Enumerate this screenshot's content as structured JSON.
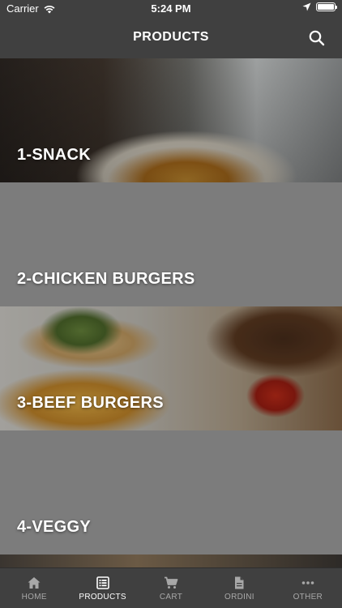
{
  "status_bar": {
    "carrier": "Carrier",
    "time": "5:24 PM"
  },
  "header": {
    "title": "PRODUCTS"
  },
  "categories": [
    {
      "label": "1-SNACK"
    },
    {
      "label": "2-CHICKEN BURGERS"
    },
    {
      "label": "3-BEEF BURGERS"
    },
    {
      "label": "4-VEGGY"
    }
  ],
  "tabs": [
    {
      "label": "HOME",
      "icon": "home-icon",
      "active": false
    },
    {
      "label": "PRODUCTS",
      "icon": "list-icon",
      "active": true
    },
    {
      "label": "CART",
      "icon": "cart-icon",
      "active": false
    },
    {
      "label": "ORDINI",
      "icon": "document-icon",
      "active": false
    },
    {
      "label": "OTHER",
      "icon": "more-icon",
      "active": false
    }
  ],
  "colors": {
    "bar_background": "#404040",
    "placeholder_gray": "#7c7c7c",
    "active_tab": "#ffffff",
    "inactive_tab": "#a8a8a8"
  }
}
